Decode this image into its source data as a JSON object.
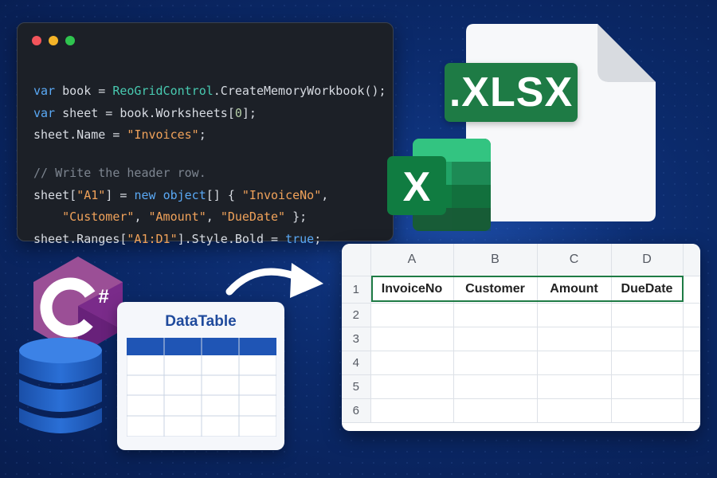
{
  "editor": {
    "lines": [
      [
        {
          "t": "var",
          "c": "kw"
        },
        {
          "t": " book = "
        },
        {
          "t": "ReoGridControl",
          "c": "ty"
        },
        {
          "t": ".CreateMemoryWorkbook();"
        }
      ],
      [
        {
          "t": "var",
          "c": "kw"
        },
        {
          "t": " sheet = book.Worksheets["
        },
        {
          "t": "0",
          "c": "num"
        },
        {
          "t": "];"
        }
      ],
      [
        {
          "t": "sheet.Name = "
        },
        {
          "t": "\"Invoices\"",
          "c": "str"
        },
        {
          "t": ";"
        }
      ],
      [
        {
          "t": "// Write the header row.",
          "c": "cm"
        }
      ],
      [
        {
          "t": "sheet["
        },
        {
          "t": "\"A1\"",
          "c": "str"
        },
        {
          "t": "] = "
        },
        {
          "t": "new",
          "c": "kw"
        },
        {
          "t": " "
        },
        {
          "t": "object",
          "c": "kw"
        },
        {
          "t": "[] { "
        },
        {
          "t": "\"InvoiceNo\"",
          "c": "str"
        },
        {
          "t": ","
        }
      ],
      [
        {
          "t": "    "
        },
        {
          "t": "\"Customer\"",
          "c": "str"
        },
        {
          "t": ", "
        },
        {
          "t": "\"Amount\"",
          "c": "str"
        },
        {
          "t": ", "
        },
        {
          "t": "\"DueDate\"",
          "c": "str"
        },
        {
          "t": " };"
        }
      ],
      [
        {
          "t": "sheet.Ranges["
        },
        {
          "t": "\"A1:D1\"",
          "c": "str"
        },
        {
          "t": "].Style.Bold = "
        },
        {
          "t": "true",
          "c": "kw"
        },
        {
          "t": ";"
        }
      ]
    ]
  },
  "file": {
    "extension": ".XLSX",
    "excel_letter": "X"
  },
  "csharp": {
    "label": "C#"
  },
  "datatable": {
    "title": "DataTable"
  },
  "spreadsheet": {
    "columns": [
      "A",
      "B",
      "C",
      "D"
    ],
    "rows": [
      "1",
      "2",
      "3",
      "4",
      "5",
      "6"
    ],
    "header_values": [
      "InvoiceNo",
      "Customer",
      "Amount",
      "DueDate"
    ]
  },
  "colors": {
    "excel_green": "#1e7b45",
    "csharp_purple": "#68217a",
    "db_blue": "#1f5fbf",
    "table_header_blue": "#1f55b5"
  }
}
